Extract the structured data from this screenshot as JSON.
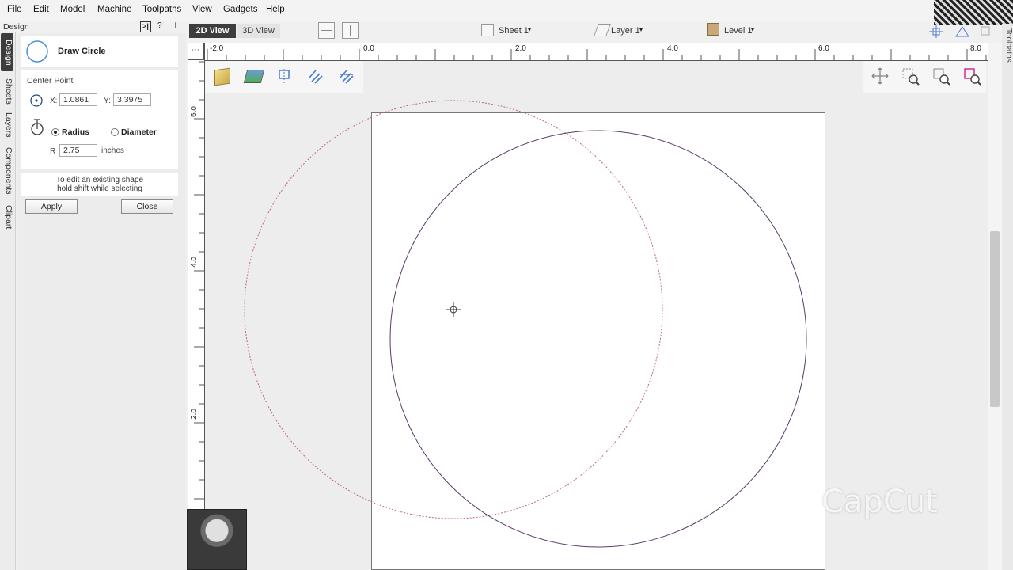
{
  "menu": [
    "File",
    "Edit",
    "Model",
    "Machine",
    "Toolpaths",
    "View",
    "Gadgets",
    "Help"
  ],
  "panel": {
    "title": "Design",
    "tool_title": "Draw Circle",
    "center_point_label": "Center Point",
    "x_label": "X:",
    "x_value": "1.0861",
    "y_label": "Y:",
    "y_value": "3.3975",
    "radius_label": "Radius",
    "diameter_label": "Diameter",
    "size_mode": "Radius",
    "r_label": "R",
    "r_value": "2.75",
    "units": "inches",
    "hint_line1": "To edit an existing shape",
    "hint_line2": "hold shift while selecting",
    "apply_label": "Apply",
    "close_label": "Close"
  },
  "side_tabs": [
    "Design",
    "Sheets",
    "Layers",
    "Components",
    "Clipart"
  ],
  "right_tab": "Toolpaths",
  "views": {
    "tab_2d": "2D View",
    "tab_3d": "3D View",
    "active": "2D View"
  },
  "selectors": {
    "sheet": "Sheet 1",
    "layer": "Layer 1",
    "level": "Level 1"
  },
  "ruler": {
    "h_labels": [
      "-2.0",
      "0.0",
      "2.0",
      "4.0",
      "6.0",
      "8.0"
    ],
    "v_labels": [
      "6.0",
      "4.0",
      "2.0"
    ]
  },
  "watermark": "CapCut",
  "colors": {
    "accent": "#4a90d9",
    "circle_preview": "#c06090",
    "circle_existing": "#5a3a6a",
    "tab_active": "#3d3d3d"
  },
  "icons": [
    "circle-tool-icon",
    "center-point-icon",
    "radius-icon",
    "pin-icon",
    "help-icon",
    "collapse-icon",
    "material-setup-icon",
    "bitmap-icon",
    "vector-offset-icon",
    "weld-icon",
    "join-icon",
    "pan-icon",
    "zoom-box-icon",
    "zoom-extents-icon",
    "zoom-selection-icon"
  ]
}
